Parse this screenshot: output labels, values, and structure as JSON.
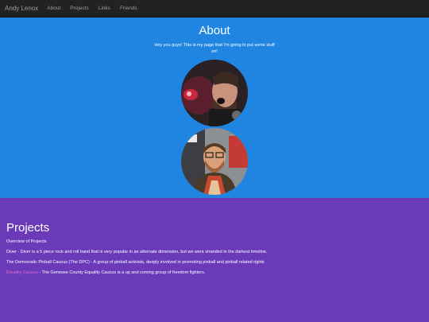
{
  "nav": {
    "brand": "Andy Lenox",
    "links": [
      "About",
      "Projects",
      "Links",
      "Friends"
    ]
  },
  "about": {
    "title": "About",
    "text": "Hey you guys! This is my page that I'm going to put some stuff on!"
  },
  "projects": {
    "title": "Projects",
    "subtitle": "Overview of Projects",
    "items": [
      {
        "name": "Diver",
        "link": false,
        "description": " - Diver is a 5 piece rock and roll band that is very popular in an alternate dimension, but we were stranded in the darkest timeline."
      },
      {
        "name": "The Democratic Pinball Caucus (The DPC)",
        "link": false,
        "description": " - A group of pinball activists, deeply involved in promoting pinball and pinball related rights"
      },
      {
        "name": "Equality Caucus",
        "link": true,
        "description": " - The Genesee County Equality Caucus is a up and coming group of freedom fighters."
      }
    ]
  },
  "colors": {
    "navbar": "#222222",
    "about_bg": "#2085e0",
    "projects_bg": "#6a3ab9",
    "link": "#e26ad0"
  }
}
